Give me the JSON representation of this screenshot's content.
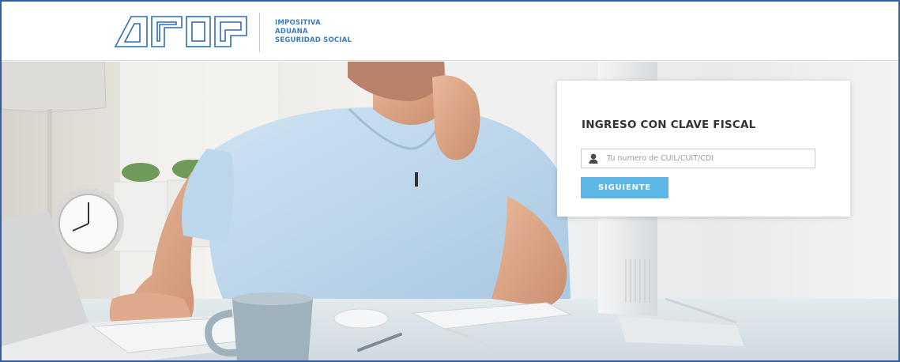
{
  "header": {
    "logo_text": "AFIP",
    "tagline": [
      "IMPOSITIVA",
      "ADUANA",
      "SEGURIDAD SOCIAL"
    ]
  },
  "login": {
    "title": "INGRESO CON CLAVE FISCAL",
    "input_placeholder": "Tu numero de CUIL/CUIT/CDI",
    "input_value": "",
    "submit_label": "SIGUIENTE"
  },
  "colors": {
    "frame_border": "#2f5fa8",
    "logo_stroke": "#2e6db4",
    "tagline": "#3a7bc1",
    "button": "#5db7e6"
  },
  "icons": {
    "input": "user-icon"
  }
}
